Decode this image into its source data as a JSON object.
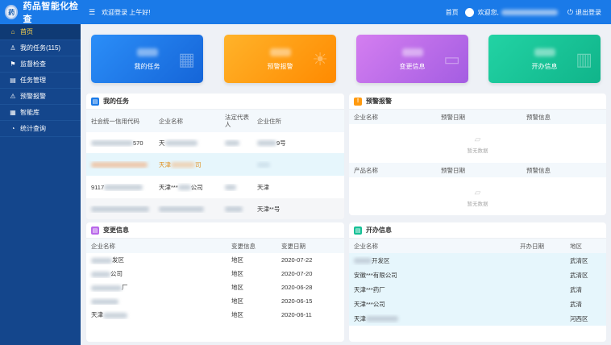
{
  "header": {
    "app_title": "药品智能化检查",
    "logo_text": "药",
    "menu_icon": "menu-icon",
    "welcome": "欢迎登录 上午好!",
    "home": "首页",
    "user_greeting": "欢迎您,",
    "logout": "退出登录"
  },
  "sidebar": {
    "items": [
      {
        "label": "首页",
        "icon": "home-icon",
        "active": true
      },
      {
        "label": "我的任务(115)",
        "icon": "user-icon"
      },
      {
        "label": "监督检查",
        "icon": "flag-icon"
      },
      {
        "label": "任务管理",
        "icon": "document-icon"
      },
      {
        "label": "预警报警",
        "icon": "alert-icon"
      },
      {
        "label": "智能库",
        "icon": "grid-icon"
      },
      {
        "label": "统计查询",
        "icon": "chart-icon"
      }
    ]
  },
  "tiles": [
    {
      "label": "我的任务",
      "color": "#1a7ae8"
    },
    {
      "label": "预警报警",
      "color": "#ff9a10"
    },
    {
      "label": "变更信息",
      "color": "#b968ea"
    },
    {
      "label": "开办信息",
      "color": "#16c096"
    }
  ],
  "tasks": {
    "title": "我的任务",
    "columns": [
      "社会统一信用代码",
      "企业名称",
      "法定代表人",
      "企业住所"
    ],
    "rows": [
      {
        "code_suffix": "570",
        "name_prefix": "天",
        "address_suffix": "9号"
      },
      {
        "code_suffix": "",
        "name_prefix": "天津",
        "name_suffix": "司",
        "address_suffix": ""
      },
      {
        "code_prefix": "9117",
        "name_prefix": "天津***",
        "name_suffix": "公司",
        "address_suffix": "天津"
      },
      {
        "code_suffix": "",
        "name_prefix": "",
        "address_suffix": "天津**号"
      }
    ]
  },
  "warnings": {
    "title": "预警报警",
    "columns": [
      "企业名称",
      "预警日期",
      "预警信息"
    ],
    "empty_text": "暂无数据",
    "product_columns": [
      "产品名称",
      "预警日期",
      "预警信息"
    ],
    "product_empty_text": "暂无数据"
  },
  "changes": {
    "title": "变更信息",
    "columns": [
      "企业名称",
      "变更信息",
      "变更日期"
    ],
    "rows": [
      {
        "name": "发区",
        "info": "地区",
        "date": "2020-07-22"
      },
      {
        "name": "公司",
        "info": "地区",
        "date": "2020-07-20"
      },
      {
        "name": "厂",
        "info": "地区",
        "date": "2020-06-28"
      },
      {
        "name": "",
        "info": "地区",
        "date": "2020-06-15"
      },
      {
        "name": "天津",
        "info": "地区",
        "date": "2020-06-11"
      }
    ]
  },
  "openings": {
    "title": "开办信息",
    "columns": [
      "企业名称",
      "开办日期",
      "地区"
    ],
    "rows": [
      {
        "name": "开发区",
        "date": "",
        "region": "武清区"
      },
      {
        "name": "安徽***有限公司",
        "date": "",
        "region": "武清区"
      },
      {
        "name": "天津***药厂",
        "date": "",
        "region": "武清"
      },
      {
        "name": "天津***公司",
        "date": "",
        "region": "武清"
      },
      {
        "name": "天津",
        "date": "",
        "region": "河西区"
      }
    ]
  }
}
